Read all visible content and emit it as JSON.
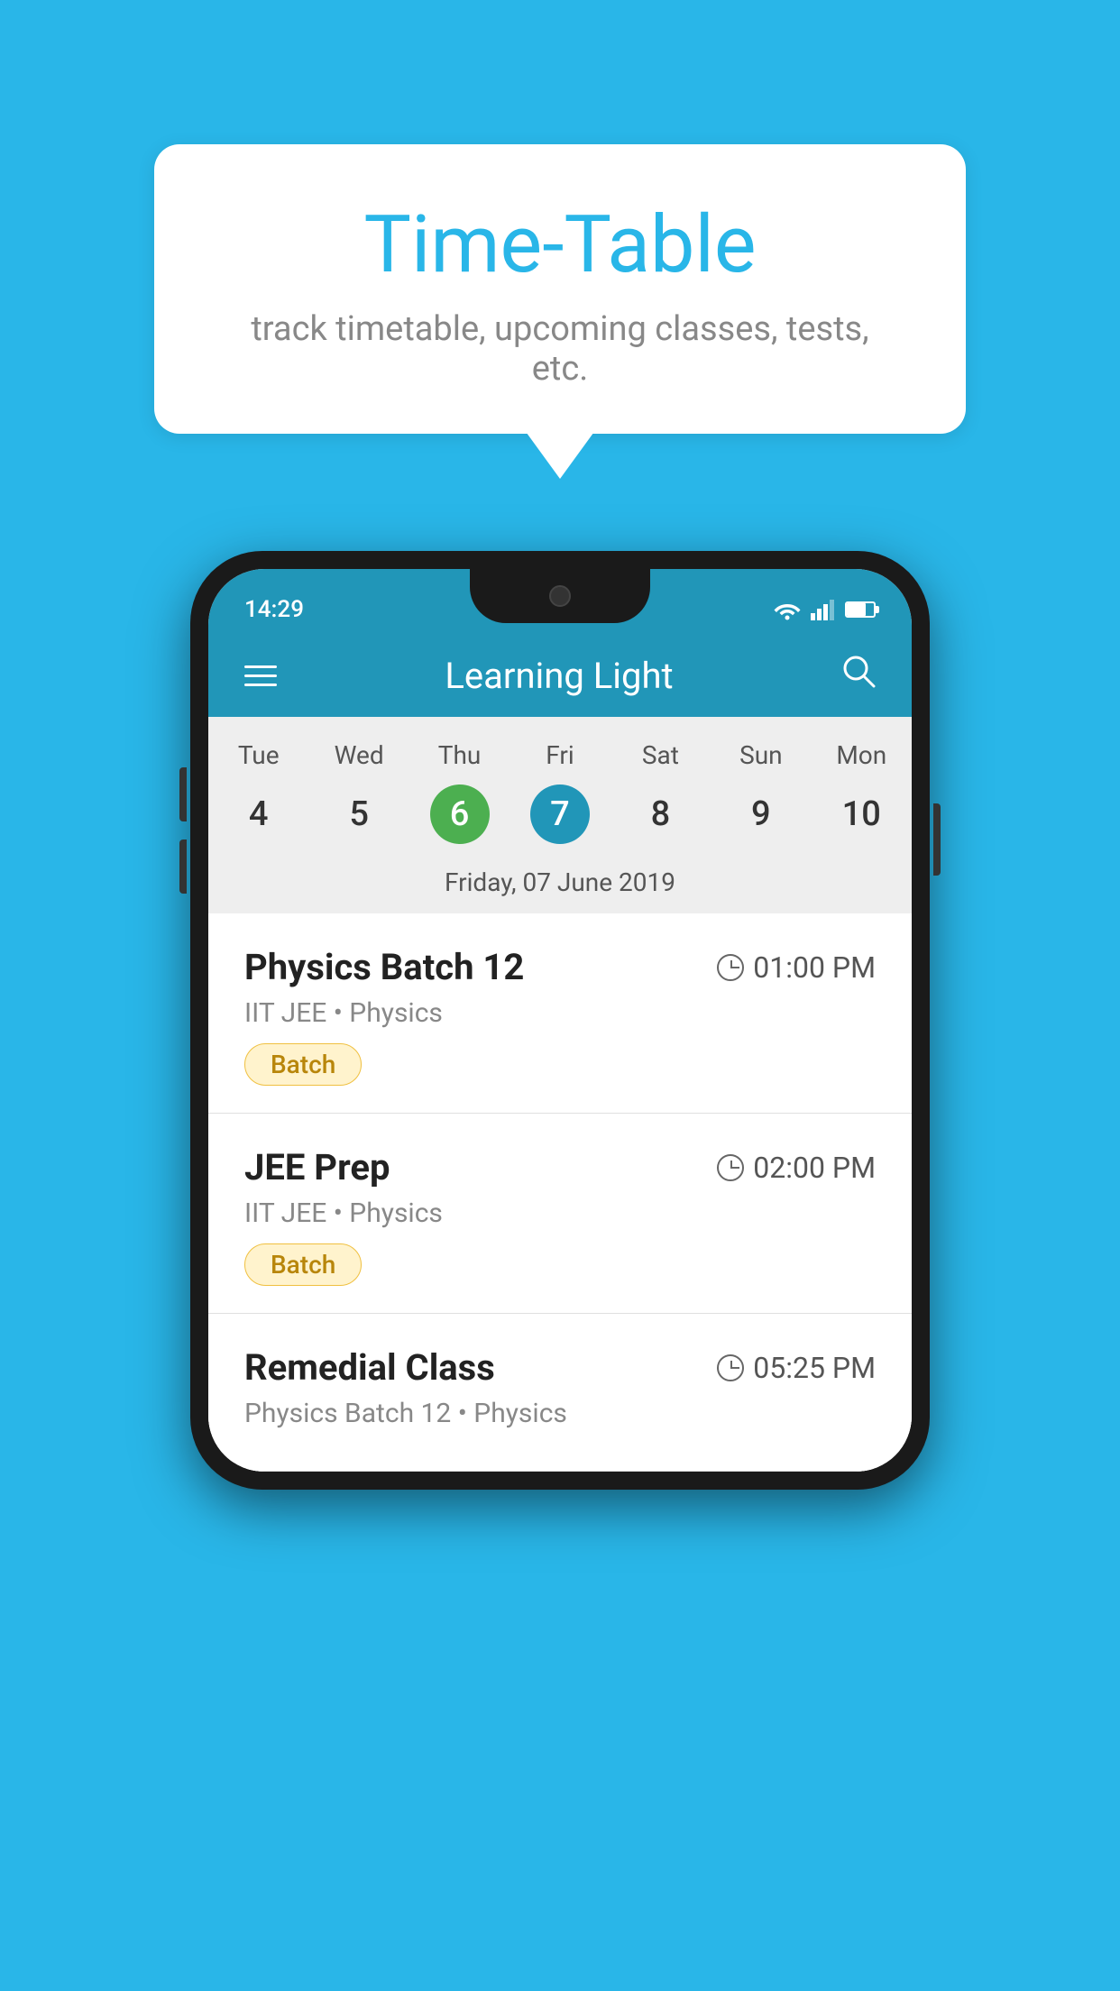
{
  "background_color": "#29b6e8",
  "tooltip": {
    "title": "Time-Table",
    "subtitle": "track timetable, upcoming classes, tests, etc."
  },
  "phone": {
    "status_bar": {
      "time": "14:29",
      "wifi": true,
      "signal": true,
      "battery": true
    },
    "app_header": {
      "title": "Learning Light",
      "menu_label": "menu",
      "search_label": "search"
    },
    "calendar": {
      "days": [
        "Tue",
        "Wed",
        "Thu",
        "Fri",
        "Sat",
        "Sun",
        "Mon"
      ],
      "dates": [
        "4",
        "5",
        "6",
        "7",
        "8",
        "9",
        "10"
      ],
      "today_index": 2,
      "selected_index": 3,
      "selected_date_label": "Friday, 07 June 2019"
    },
    "schedule": [
      {
        "name": "Physics Batch 12",
        "time": "01:00 PM",
        "subtitle": "IIT JEE • Physics",
        "tag": "Batch"
      },
      {
        "name": "JEE Prep",
        "time": "02:00 PM",
        "subtitle": "IIT JEE • Physics",
        "tag": "Batch"
      },
      {
        "name": "Remedial Class",
        "time": "05:25 PM",
        "subtitle": "Physics Batch 12 • Physics",
        "tag": null
      }
    ]
  }
}
